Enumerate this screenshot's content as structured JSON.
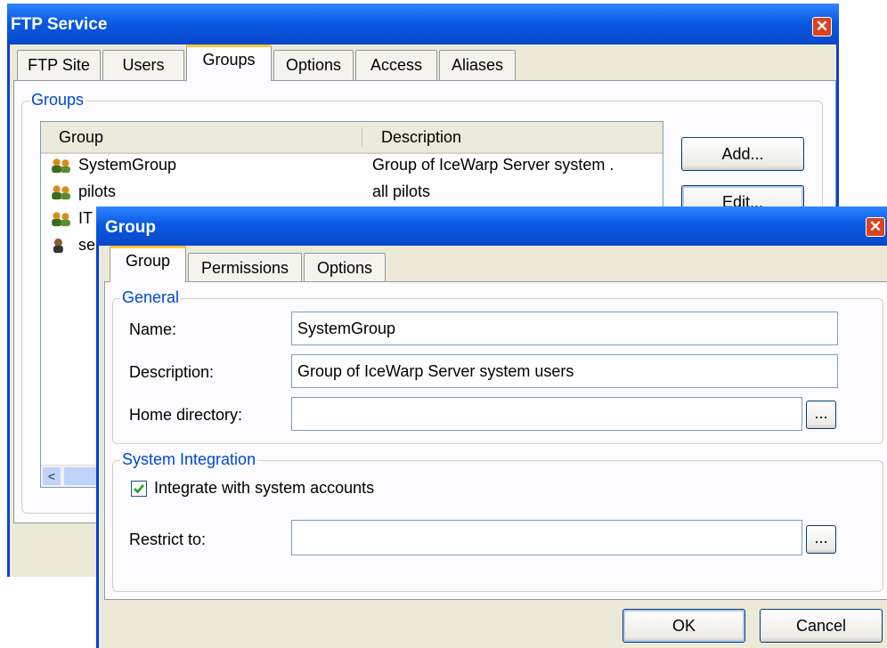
{
  "ftp_window": {
    "title": "FTP Service",
    "close_glyph": "✕",
    "tabs": [
      "FTP Site",
      "Users",
      "Groups",
      "Options",
      "Access",
      "Aliases"
    ],
    "active_tab": "Groups",
    "groupbox_label": "Groups",
    "columns": [
      "Group",
      "Description"
    ],
    "rows": [
      {
        "icon": "users-icon",
        "group": "SystemGroup",
        "description": "Group of IceWarp Server system ."
      },
      {
        "icon": "users-icon",
        "group": "pilots",
        "description": "all pilots"
      },
      {
        "icon": "users-icon",
        "group": "IT",
        "description": ""
      },
      {
        "icon": "user-icon",
        "group": "se",
        "description": ""
      }
    ],
    "buttons": {
      "add": "Add...",
      "edit": "Edit..."
    },
    "scroll_left_glyph": "<"
  },
  "group_dialog": {
    "title": "Group",
    "close_glyph": "✕",
    "tabs": [
      "Group",
      "Permissions",
      "Options"
    ],
    "active_tab": "Group",
    "general": {
      "label": "General",
      "name_label": "Name:",
      "name_value": "SystemGroup",
      "description_label": "Description:",
      "description_value": "Group of IceWarp Server system users",
      "home_label": "Home directory:",
      "home_value": "",
      "browse_label": "..."
    },
    "integration": {
      "label": "System Integration",
      "checkbox_label": "Integrate with system accounts",
      "checkbox_checked": true,
      "restrict_label": "Restrict to:",
      "restrict_value": "",
      "browse_label": "..."
    },
    "ok_label": "OK",
    "cancel_label": "Cancel"
  },
  "colors": {
    "title_blue": "#0a5ae3",
    "accent_orange": "#ffc83c",
    "groupbox_text": "#0046d5",
    "window_bg": "#ece9d8"
  }
}
